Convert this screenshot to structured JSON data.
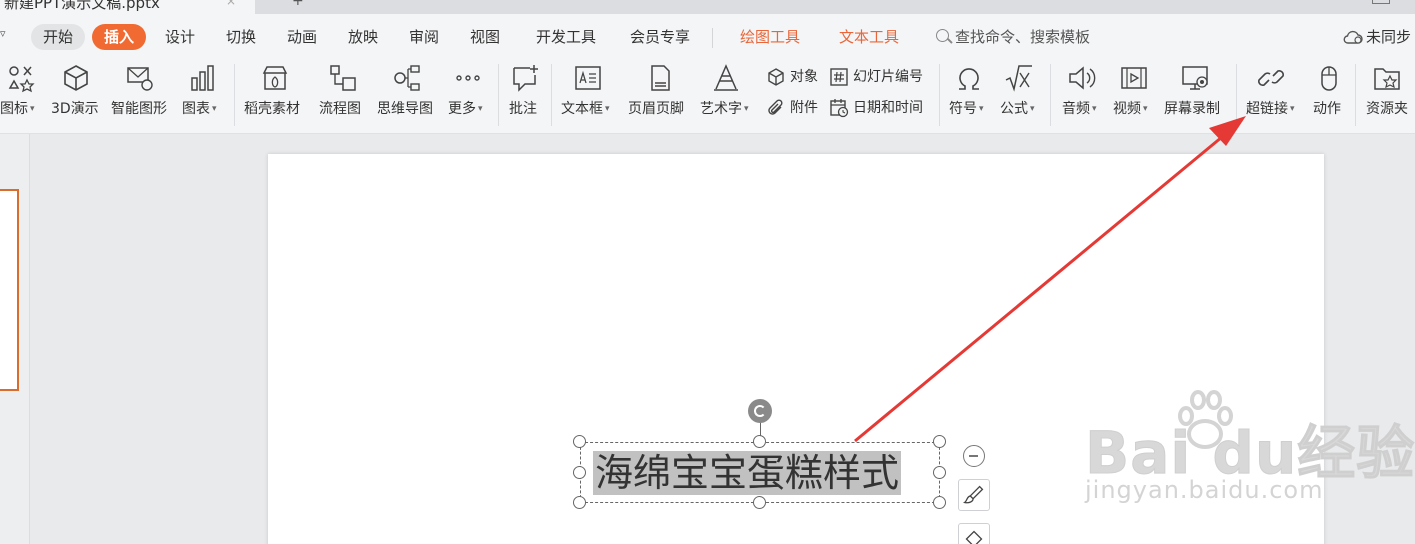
{
  "titlebar": {
    "doc_title": "新建PPT演示文稿.pptx",
    "close_glyph": "×",
    "new_tab_glyph": "+"
  },
  "menu": {
    "chevron": "▿",
    "items": [
      "开始",
      "插入",
      "设计",
      "切换",
      "动画",
      "放映",
      "审阅",
      "视图",
      "开发工具",
      "会员专享"
    ],
    "tools": [
      "绘图工具",
      "文本工具"
    ],
    "search_placeholder": "查找命令、搜索模板",
    "sync_label": "未同步"
  },
  "ribbon": {
    "icons_label": "图标",
    "3d_label": "3D演示",
    "smartart_label": "智能图形",
    "chart_label": "图表",
    "daoke_label": "稻壳素材",
    "flowchart_label": "流程图",
    "mindmap_label": "思维导图",
    "more_label": "更多",
    "comment_label": "批注",
    "textbox_label": "文本框",
    "header_footer_label": "页眉页脚",
    "wordart_label": "艺术字",
    "object_label": "对象",
    "attachment_label": "附件",
    "slide_number_label": "幻灯片编号",
    "datetime_label": "日期和时间",
    "symbol_label": "符号",
    "formula_label": "公式",
    "audio_label": "音频",
    "video_label": "视频",
    "screen_record_label": "屏幕录制",
    "hyperlink_label": "超链接",
    "action_label": "动作",
    "resource_label": "资源夹",
    "dropdown_glyph": "▾"
  },
  "slide": {
    "text": "海绵宝宝蛋糕样式"
  },
  "watermark": {
    "logo": "Bai  du经验",
    "url": "jingyan.baidu.com"
  },
  "colors": {
    "accent": "#f06a32",
    "tool_text": "#e8663a",
    "arrow": "#e53935",
    "selection": "#c1c1c1"
  }
}
